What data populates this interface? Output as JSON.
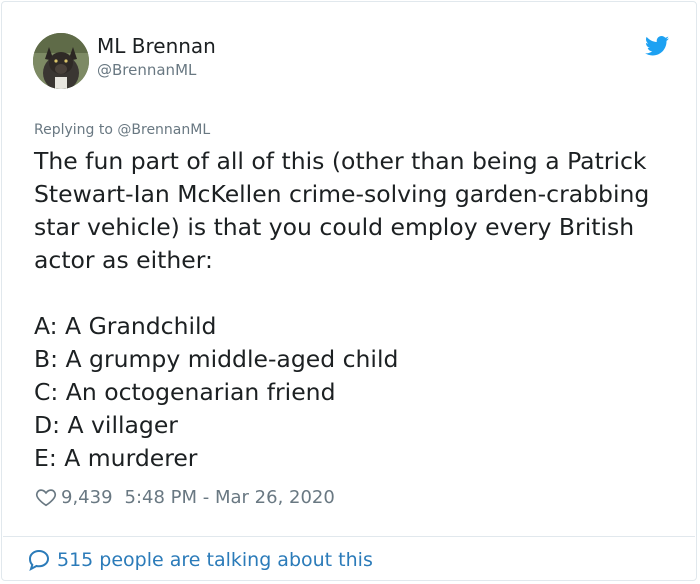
{
  "author": {
    "name": "ML Brennan",
    "handle": "@BrennanML",
    "avatar_icon": "fox-avatar"
  },
  "reply": {
    "prefix": "Replying to",
    "mention": "@BrennanML"
  },
  "tweet": {
    "paragraph1": "The fun part of all of this (other than being a Patrick Stewart-Ian McKellen crime-solving garden-crabbing star vehicle) is that you could employ every British actor as either:",
    "options": [
      "A: A Grandchild",
      "B: A grumpy middle-aged child",
      "C: An octogenarian friend",
      "D: A villager",
      "E: A murderer"
    ]
  },
  "meta": {
    "likes": "9,439",
    "timestamp": "5:48 PM - Mar 26, 2020"
  },
  "conversation": {
    "label": "515 people are talking about this"
  },
  "colors": {
    "twitter_blue": "#1da1f2",
    "link_blue": "#2b7bb9",
    "secondary_text": "#697882",
    "primary_text": "#1c2022",
    "border": "#e1e8ed"
  }
}
